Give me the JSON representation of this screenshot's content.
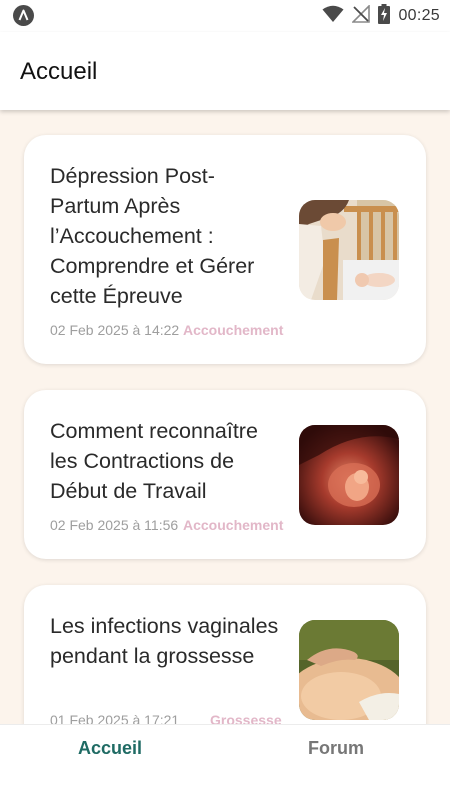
{
  "status_bar": {
    "time": "00:25",
    "icons": [
      "app-launcher-icon",
      "wifi-icon",
      "no-signal-icon",
      "battery-charging-icon"
    ]
  },
  "app_bar": {
    "title": "Accueil"
  },
  "articles": [
    {
      "title": "Dépression Post-Partum Après l’Accouchement : Comprendre et Gérer cette Épreuve",
      "date": "02 Feb 2025 à 14:22",
      "category": "Accouchement",
      "image": "mother-with-baby-in-crib"
    },
    {
      "title": "Comment reconnaître les Contractions de Début de Travail",
      "date": "02 Feb 2025 à 11:56",
      "category": "Accouchement",
      "image": "fetus-in-womb"
    },
    {
      "title": "Les infections vaginales pendant la grossesse",
      "date": "01 Feb 2025 à 17:21",
      "category": "Grossesse",
      "image": "pregnant-belly"
    }
  ],
  "bottom_nav": {
    "home_label": "Accueil",
    "forum_label": "Forum",
    "active": "Accueil"
  },
  "colors": {
    "accent": "#1f6b64",
    "category": "#e2b7c8",
    "background": "#fcf4ec"
  }
}
